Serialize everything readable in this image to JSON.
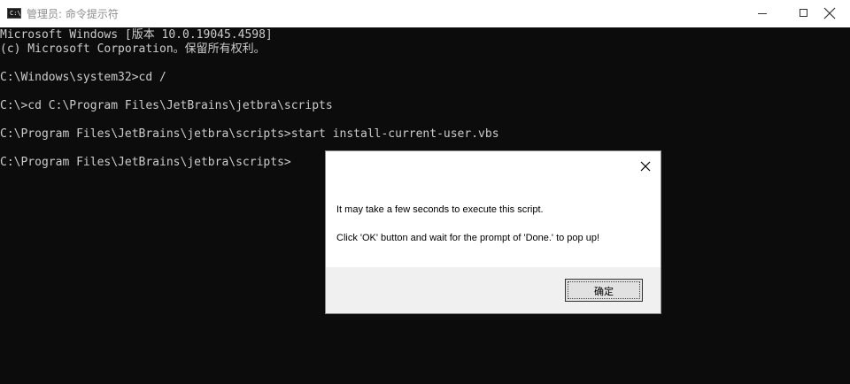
{
  "window": {
    "icon_text": "C:\\",
    "title": "管理员: 命令提示符"
  },
  "console": {
    "lines": [
      "Microsoft Windows [版本 10.0.19045.4598]",
      "(c) Microsoft Corporation。保留所有权利。",
      "",
      "C:\\Windows\\system32>cd /",
      "",
      "C:\\>cd C:\\Program Files\\JetBrains\\jetbra\\scripts",
      "",
      "C:\\Program Files\\JetBrains\\jetbra\\scripts>start install-current-user.vbs",
      "",
      "C:\\Program Files\\JetBrains\\jetbra\\scripts>"
    ]
  },
  "dialog": {
    "message_1": "It may take a few seconds to execute this script.",
    "message_2": "Click 'OK' button and wait for the prompt of 'Done.' to pop up!",
    "ok_label": "确定"
  },
  "colors": {
    "console_bg": "#0c0c0c",
    "console_text": "#cccccc",
    "dialog_bg": "#ffffff",
    "dialog_footer_bg": "#f0f0f0"
  }
}
